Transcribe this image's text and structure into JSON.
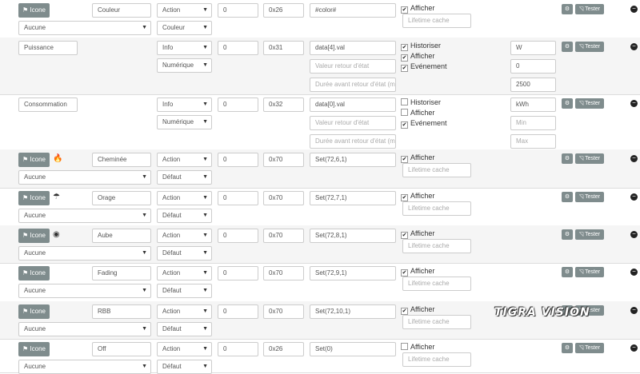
{
  "rows": [
    {
      "name": "Couleur",
      "icon_button": "Icone",
      "type": "Action",
      "subtype": "Couleur",
      "object_id": "Aucune",
      "val1": "0",
      "addr": "0x26",
      "cmd": "#color#",
      "chk": [
        {
          "label": "Afficher",
          "checked": true
        }
      ],
      "lifetime_placeholder": "Lifetime cache"
    },
    {
      "name": "Puissance",
      "type": "Info",
      "subtype": "Numérique",
      "val1": "0",
      "addr": "0x31",
      "cmd": "data[4].val",
      "retour_placeholder": "Valeur retour d'état",
      "duree_placeholder": "Durée avant retour d'état (mi",
      "chk": [
        {
          "label": "Historiser",
          "checked": true
        },
        {
          "label": "Afficher",
          "checked": true
        },
        {
          "label": "Evénement",
          "checked": true
        }
      ],
      "unit": "W",
      "min": "0",
      "max": "2500"
    },
    {
      "name": "Consommation",
      "type": "Info",
      "subtype": "Numérique",
      "val1": "0",
      "addr": "0x32",
      "cmd": "data[0].val",
      "retour_placeholder": "Valeur retour d'état",
      "duree_placeholder": "Durée avant retour d'état (mi",
      "chk": [
        {
          "label": "Historiser",
          "checked": false
        },
        {
          "label": "Afficher",
          "checked": false
        },
        {
          "label": "Evénement",
          "checked": true
        }
      ],
      "unit": "kWh",
      "min_placeholder": "Min",
      "max_placeholder": "Max"
    },
    {
      "name": "Cheminée",
      "icon_button": "Icone",
      "glyph": "fire-icon",
      "glyph_char": "🔥",
      "type": "Action",
      "subtype": "Défaut",
      "object_id": "Aucune",
      "val1": "0",
      "addr": "0x70",
      "cmd": "Set(72,6,1)",
      "chk": [
        {
          "label": "Afficher",
          "checked": true
        }
      ],
      "lifetime_placeholder": "Lifetime cache"
    },
    {
      "name": "Orage",
      "icon_button": "Icone",
      "glyph": "storm-icon",
      "glyph_char": "☂",
      "type": "Action",
      "subtype": "Défaut",
      "object_id": "Aucune",
      "val1": "0",
      "addr": "0x70",
      "cmd": "Set(72,7,1)",
      "chk": [
        {
          "label": "Afficher",
          "checked": true
        }
      ],
      "lifetime_placeholder": "Lifetime cache"
    },
    {
      "name": "Aube",
      "icon_button": "Icone",
      "glyph": "sunrise-icon",
      "glyph_char": "◉",
      "type": "Action",
      "subtype": "Défaut",
      "object_id": "Aucune",
      "val1": "0",
      "addr": "0x70",
      "cmd": "Set(72,8,1)",
      "chk": [
        {
          "label": "Afficher",
          "checked": true
        }
      ],
      "lifetime_placeholder": "Lifetime cache"
    },
    {
      "name": "Fading",
      "icon_button": "Icone",
      "type": "Action",
      "subtype": "Défaut",
      "object_id": "Aucune",
      "val1": "0",
      "addr": "0x70",
      "cmd": "Set(72,9,1)",
      "chk": [
        {
          "label": "Afficher",
          "checked": true
        }
      ],
      "lifetime_placeholder": "Lifetime cache"
    },
    {
      "name": "RBB",
      "icon_button": "Icone",
      "type": "Action",
      "subtype": "Défaut",
      "object_id": "Aucune",
      "val1": "0",
      "addr": "0x70",
      "cmd": "Set(72,10,1)",
      "chk": [
        {
          "label": "Afficher",
          "checked": true
        }
      ],
      "lifetime_placeholder": "Lifetime cache"
    },
    {
      "name": "Off",
      "icon_button": "Icone",
      "type": "Action",
      "subtype": "Défaut",
      "object_id": "Aucune",
      "val1": "0",
      "addr": "0x26",
      "cmd": "Set(0)",
      "chk": [
        {
          "label": "Afficher",
          "checked": false
        }
      ],
      "lifetime_placeholder": "Lifetime cache"
    }
  ],
  "tools": {
    "config_icon": "gears-icon",
    "tester_label": "Tester",
    "tester_icon": "rss-icon",
    "remove_icon": "minus-circle-icon"
  },
  "watermark": "TIGRA VISION",
  "colors": {
    "button_bg": "#7f8c8d",
    "row_alt_bg": "#f5f5f5",
    "border": "#cccccc"
  }
}
